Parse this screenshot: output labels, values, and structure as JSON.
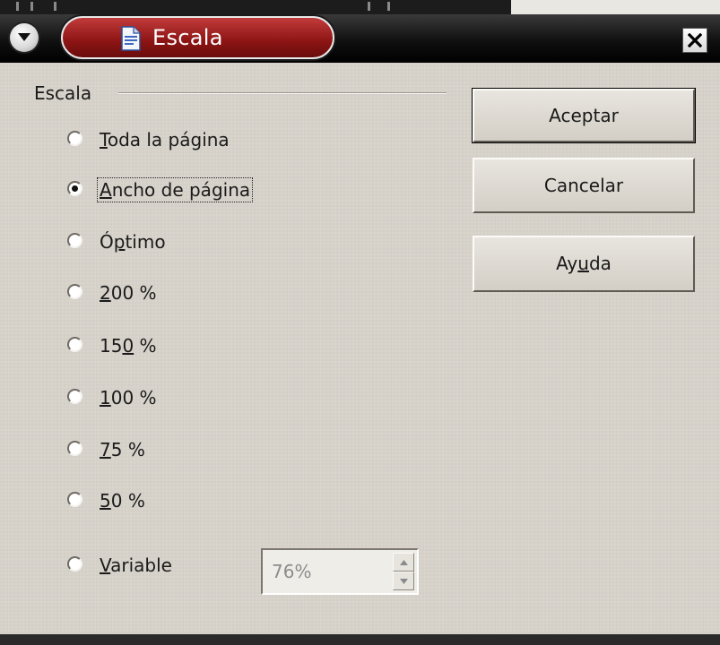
{
  "window": {
    "title": "Escala",
    "icons": {
      "menu": "chevron-down-icon",
      "document": "document-icon",
      "close": "close-x-icon"
    }
  },
  "group": {
    "label": "Escala"
  },
  "options": [
    {
      "id": "whole-page",
      "pre": "",
      "mn": "T",
      "post": "oda la página",
      "checked": false
    },
    {
      "id": "page-width",
      "pre": "",
      "mn": "A",
      "post": "ncho de página",
      "checked": true
    },
    {
      "id": "optimal",
      "pre": "Ó",
      "mn": "p",
      "post": "timo",
      "checked": false
    },
    {
      "id": "200",
      "pre": "",
      "mn": "2",
      "post": "00 %",
      "checked": false
    },
    {
      "id": "150",
      "pre": "15",
      "mn": "0",
      "post": " %",
      "checked": false
    },
    {
      "id": "100",
      "pre": "",
      "mn": "1",
      "post": "00 %",
      "checked": false
    },
    {
      "id": "75",
      "pre": "",
      "mn": "7",
      "post": "5 %",
      "checked": false
    },
    {
      "id": "50",
      "pre": "",
      "mn": "5",
      "post": "0 %",
      "checked": false
    },
    {
      "id": "variable",
      "pre": "",
      "mn": "V",
      "post": "ariable",
      "checked": false
    }
  ],
  "variable_field": {
    "value": "76%"
  },
  "buttons": {
    "ok": {
      "pre": "Aceptar",
      "mn": "",
      "post": ""
    },
    "cancel": {
      "pre": "Cancelar",
      "mn": "",
      "post": ""
    },
    "help": {
      "pre": "Ay",
      "mn": "u",
      "post": "da"
    }
  },
  "colors": {
    "dialog_bg": "#d6d2ca",
    "title_pill": "#8c1414",
    "title_text": "#ffffff"
  }
}
